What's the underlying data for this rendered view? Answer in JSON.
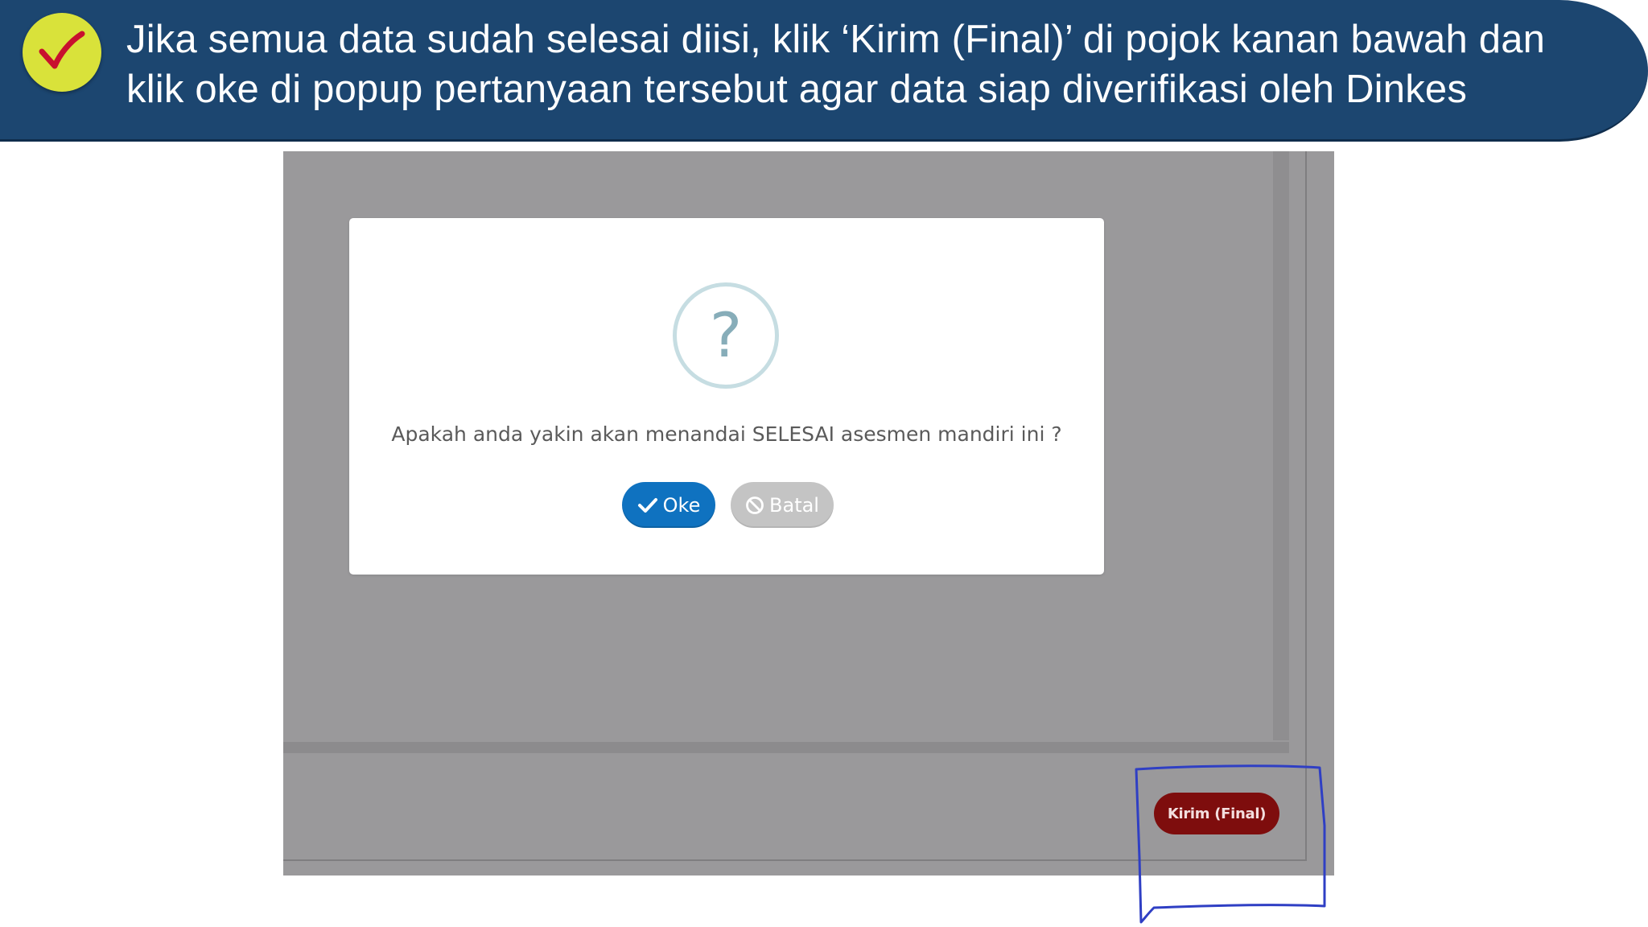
{
  "banner": {
    "line1": "Jika semua data sudah selesai diisi, klik ‘Kirim (Final)’ di pojok kanan bawah dan",
    "line2": "klik oke di popup pertanyaan tersebut agar data siap diverifikasi oleh Dinkes",
    "badge_icon": "checkmark-icon",
    "colors": {
      "banner_bg": "#1c4670",
      "badge_bg": "#d9e23a",
      "check_color": "#c8102e"
    }
  },
  "dialog": {
    "icon": "question-icon",
    "question_glyph": "?",
    "message": "Apakah anda yakin akan menandai SELESAI asesmen mandiri ini ?",
    "ok_label": "Oke",
    "ok_icon": "check-icon",
    "cancel_label": "Batal",
    "cancel_icon": "ban-icon",
    "colors": {
      "ok_bg": "#0f72c0",
      "cancel_bg": "#c4c4c4"
    }
  },
  "footer": {
    "final_label": "Kirim (Final)",
    "colors": {
      "final_bg": "#7e0d0d",
      "highlight": "#2f3fc4"
    }
  }
}
